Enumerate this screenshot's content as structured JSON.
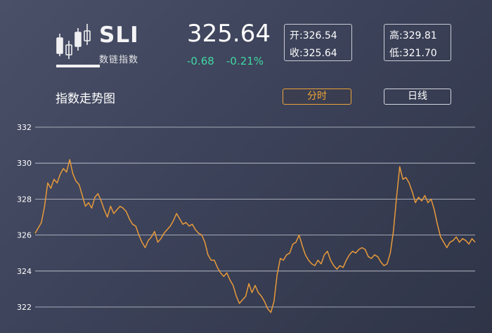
{
  "logo": {
    "name": "SLI",
    "subtitle": "数链指数"
  },
  "quote": {
    "price": "325.64",
    "change": "-0.68",
    "change_pct": "-0.21%",
    "open_label": "开:326.54",
    "close_label": "收:325.64",
    "high_label": "高:329.81",
    "low_label": "低:321.70"
  },
  "section": {
    "title": "指数走势图",
    "tabs": [
      {
        "label": "分时",
        "active": true
      },
      {
        "label": "日线",
        "active": false
      }
    ]
  },
  "colors": {
    "accent": "#f0a537",
    "up_green": "#41d7a4",
    "line": "#e89a3a",
    "grid": "#c9ccd6"
  },
  "chart_data": {
    "type": "line",
    "title": "",
    "xlabel": "",
    "ylabel": "",
    "ylim": [
      321.5,
      332.5
    ],
    "y_ticks": [
      332,
      330,
      328,
      326,
      324,
      322
    ],
    "grid": true,
    "series": [
      {
        "values": [
          326.1,
          326.4,
          326.7,
          327.6,
          328.9,
          328.6,
          329.1,
          328.9,
          329.4,
          329.7,
          329.5,
          330.2,
          329.4,
          329.0,
          328.8,
          328.2,
          327.6,
          327.8,
          327.5,
          328.1,
          328.3,
          327.9,
          327.4,
          327.0,
          327.6,
          327.2,
          327.4,
          327.6,
          327.5,
          327.3,
          326.9,
          326.6,
          326.5,
          326.0,
          325.6,
          325.3,
          325.7,
          325.9,
          326.2,
          325.6,
          325.8,
          326.1,
          326.3,
          326.5,
          326.8,
          327.2,
          326.9,
          326.6,
          326.7,
          326.5,
          326.6,
          326.3,
          326.1,
          326.0,
          325.6,
          324.9,
          324.6,
          324.6,
          324.2,
          323.9,
          323.7,
          323.9,
          323.5,
          323.2,
          322.6,
          322.2,
          322.4,
          322.6,
          323.3,
          322.8,
          323.2,
          322.8,
          322.6,
          322.3,
          321.9,
          321.7,
          322.3,
          323.8,
          324.7,
          324.6,
          324.9,
          325.0,
          325.5,
          325.6,
          326.0,
          325.4,
          324.9,
          324.6,
          324.4,
          324.3,
          324.6,
          324.4,
          324.9,
          325.1,
          324.6,
          324.3,
          324.1,
          324.3,
          324.2,
          324.6,
          324.9,
          325.1,
          325.0,
          325.2,
          325.3,
          325.2,
          324.8,
          324.7,
          324.9,
          324.8,
          324.5,
          324.3,
          324.4,
          325.0,
          326.2,
          328.1,
          329.8,
          329.1,
          329.2,
          328.9,
          328.4,
          327.8,
          328.1,
          327.9,
          328.2,
          327.8,
          328.0,
          327.4,
          326.6,
          325.9,
          325.6,
          325.3,
          325.6,
          325.7,
          325.9,
          325.6,
          325.8,
          325.7,
          325.5,
          325.8,
          325.6
        ]
      }
    ]
  }
}
